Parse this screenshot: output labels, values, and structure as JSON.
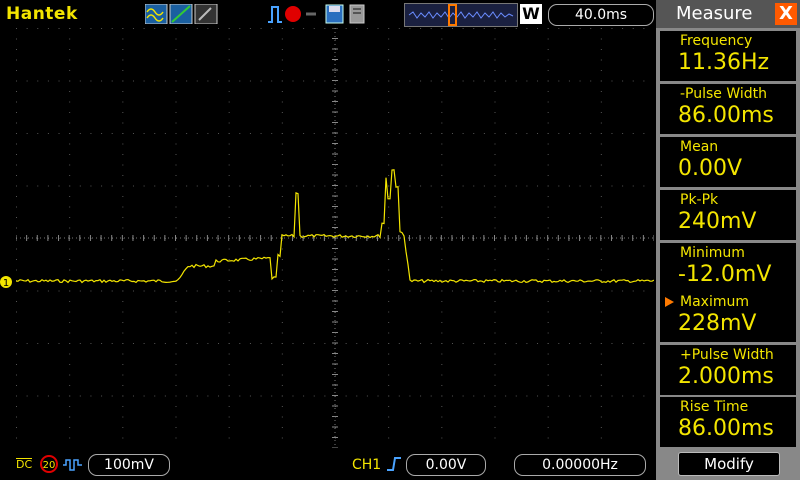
{
  "brand": "Hantek",
  "header": {
    "mode_badge": "W",
    "timebase": "40.0ms"
  },
  "channel": {
    "marker": "1"
  },
  "bottom": {
    "coupling": "DC",
    "bw_limit": "20",
    "volts_div": "100mV",
    "trigger_source": "CH1",
    "trigger_level": "0.00V",
    "trigger_freq": "0.00000Hz"
  },
  "panel": {
    "title": "Measure",
    "close": "X",
    "items": [
      {
        "label": "Frequency",
        "value": "11.36Hz"
      },
      {
        "label": "-Pulse Width",
        "value": "86.00ms"
      },
      {
        "label": "Mean",
        "value": "0.00V"
      },
      {
        "label": "Pk-Pk",
        "value": "240mV"
      },
      {
        "label": "Minimum",
        "value": "-12.0mV"
      },
      {
        "label": "Maximum",
        "value": "228mV"
      },
      {
        "label": "+Pulse Width",
        "value": "2.000ms"
      },
      {
        "label": "Rise Time",
        "value": "86.00ms"
      }
    ],
    "modify": "Modify"
  },
  "colors": {
    "trace": "#f3e500",
    "accent": "#ff7a00",
    "grid": "#666666"
  }
}
